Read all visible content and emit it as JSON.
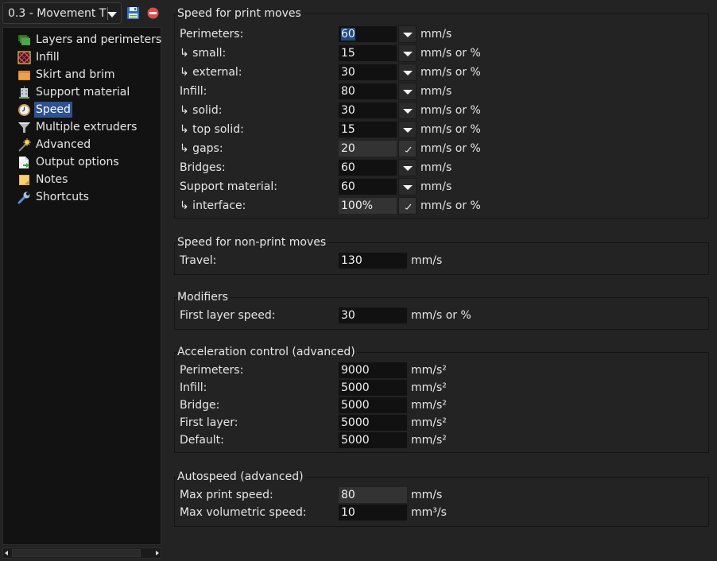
{
  "preset": {
    "selected": "0.3 - Movement T",
    "save_icon": "floppy-disk-icon",
    "delete_icon": "red-minus-circle-icon"
  },
  "sidebar": {
    "selected_index": 4,
    "items": [
      {
        "label": "Layers and perimeters",
        "icon": "layers-icon"
      },
      {
        "label": "Infill",
        "icon": "infill-icon"
      },
      {
        "label": "Skirt and brim",
        "icon": "box-icon"
      },
      {
        "label": "Support material",
        "icon": "building-icon"
      },
      {
        "label": "Speed",
        "icon": "clock-icon"
      },
      {
        "label": "Multiple extruders",
        "icon": "funnel-icon"
      },
      {
        "label": "Advanced",
        "icon": "wand-icon"
      },
      {
        "label": "Output options",
        "icon": "page-export-icon"
      },
      {
        "label": "Notes",
        "icon": "note-icon"
      },
      {
        "label": "Shortcuts",
        "icon": "wrench-icon"
      }
    ]
  },
  "groups": {
    "print_moves": {
      "title": "Speed for print moves",
      "rows": [
        {
          "label": "Perimeters:",
          "value": "60",
          "unit": "mm/s"
        },
        {
          "label": "↳ small:",
          "value": "15",
          "unit": "mm/s or %"
        },
        {
          "label": "↳ external:",
          "value": "30",
          "unit": "mm/s or %"
        },
        {
          "label": "Infill:",
          "value": "80",
          "unit": "mm/s"
        },
        {
          "label": "↳ solid:",
          "value": "30",
          "unit": "mm/s or %"
        },
        {
          "label": "↳ top solid:",
          "value": "15",
          "unit": "mm/s or %"
        },
        {
          "label": "↳ gaps:",
          "value": "20",
          "unit": "mm/s or %"
        },
        {
          "label": "Bridges:",
          "value": "60",
          "unit": "mm/s"
        },
        {
          "label": "Support material:",
          "value": "60",
          "unit": "mm/s"
        },
        {
          "label": "↳ interface:",
          "value": "100%",
          "unit": "mm/s or %"
        }
      ]
    },
    "non_print_moves": {
      "title": "Speed for non-print moves",
      "rows": [
        {
          "label": "Travel:",
          "value": "130",
          "unit": "mm/s"
        }
      ]
    },
    "modifiers": {
      "title": "Modifiers",
      "rows": [
        {
          "label": "First layer speed:",
          "value": "30",
          "unit": "mm/s or %"
        }
      ]
    },
    "acceleration": {
      "title": "Acceleration control (advanced)",
      "rows": [
        {
          "label": "Perimeters:",
          "value": "9000",
          "unit": "mm/s²"
        },
        {
          "label": "Infill:",
          "value": "5000",
          "unit": "mm/s²"
        },
        {
          "label": "Bridge:",
          "value": "5000",
          "unit": "mm/s²"
        },
        {
          "label": "First layer:",
          "value": "5000",
          "unit": "mm/s²"
        },
        {
          "label": "Default:",
          "value": "5000",
          "unit": "mm/s²"
        }
      ]
    },
    "autospeed": {
      "title": "Autospeed (advanced)",
      "rows": [
        {
          "label": "Max print speed:",
          "value": "80",
          "unit": "mm/s"
        },
        {
          "label": "Max volumetric speed:",
          "value": "10",
          "unit": "mm³/s"
        }
      ]
    }
  }
}
